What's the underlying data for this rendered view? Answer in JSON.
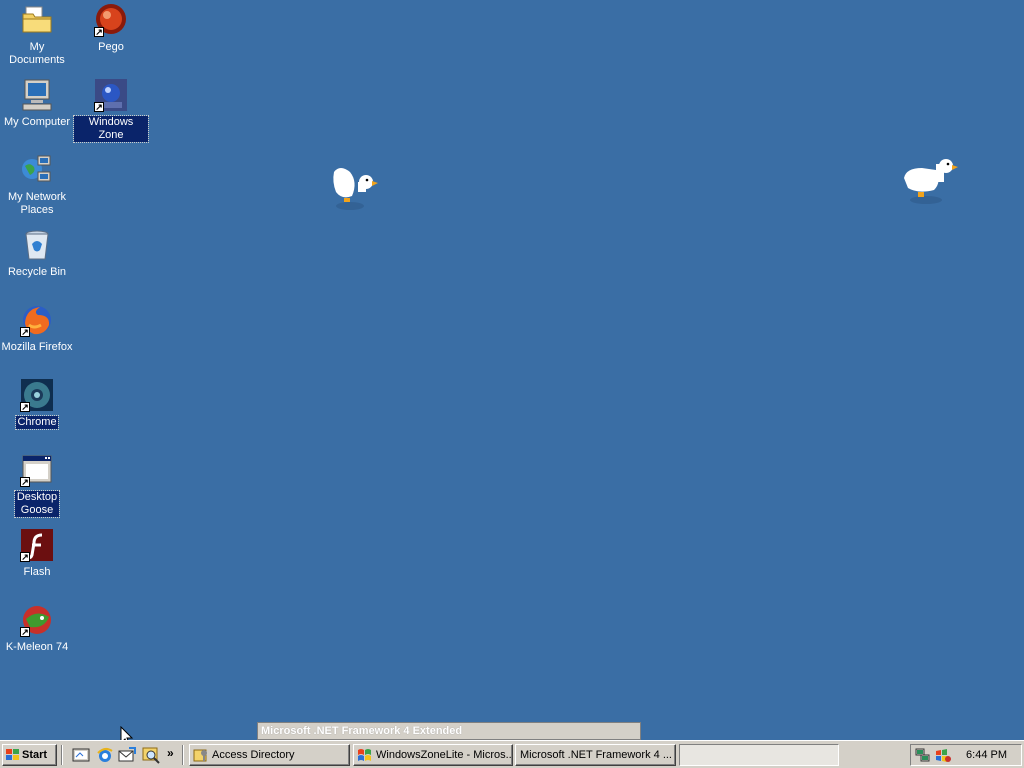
{
  "desktop": {
    "background_color": "#3a6ea5",
    "icons": [
      {
        "label": "My Documents",
        "icon": "folder-documents-icon"
      },
      {
        "label": "Pego",
        "icon": "pego-shortcut-icon"
      },
      {
        "label": "My Computer",
        "icon": "computer-icon"
      },
      {
        "label": "Windows Zone",
        "icon": "windows-zone-shortcut-icon"
      },
      {
        "label": "My Network Places",
        "icon": "network-places-icon"
      },
      {
        "label": "Recycle Bin",
        "icon": "recycle-bin-icon"
      },
      {
        "label": "Mozilla Firefox",
        "icon": "firefox-icon"
      },
      {
        "label": "Chrome",
        "icon": "chrome-icon"
      },
      {
        "label": "Desktop Goose",
        "icon": "desktop-goose-icon"
      },
      {
        "label": "Flash",
        "icon": "flash-icon"
      },
      {
        "label": "K-Meleon 74",
        "icon": "k-meleon-icon"
      }
    ]
  },
  "tooltip": {
    "text": "Microsoft .NET Framework 4 Extended"
  },
  "taskbar": {
    "start_label": "Start",
    "quick_launch": [
      {
        "icon": "show-desktop-icon"
      },
      {
        "icon": "internet-explorer-icon"
      },
      {
        "icon": "outlook-express-icon"
      },
      {
        "icon": "search-icon"
      }
    ],
    "chevron": "»",
    "tasks": [
      {
        "label": "Access Directory",
        "icon": "access-directory-icon"
      },
      {
        "label": "WindowsZoneLite - Micros...",
        "icon": "windows-flag-icon"
      },
      {
        "label": "Microsoft .NET Framework 4 ...",
        "icon": ""
      },
      {
        "label": "",
        "icon": ""
      }
    ],
    "tray": {
      "icons": [
        "network-icon",
        "windows-update-icon"
      ],
      "clock": "6:44 PM"
    }
  }
}
